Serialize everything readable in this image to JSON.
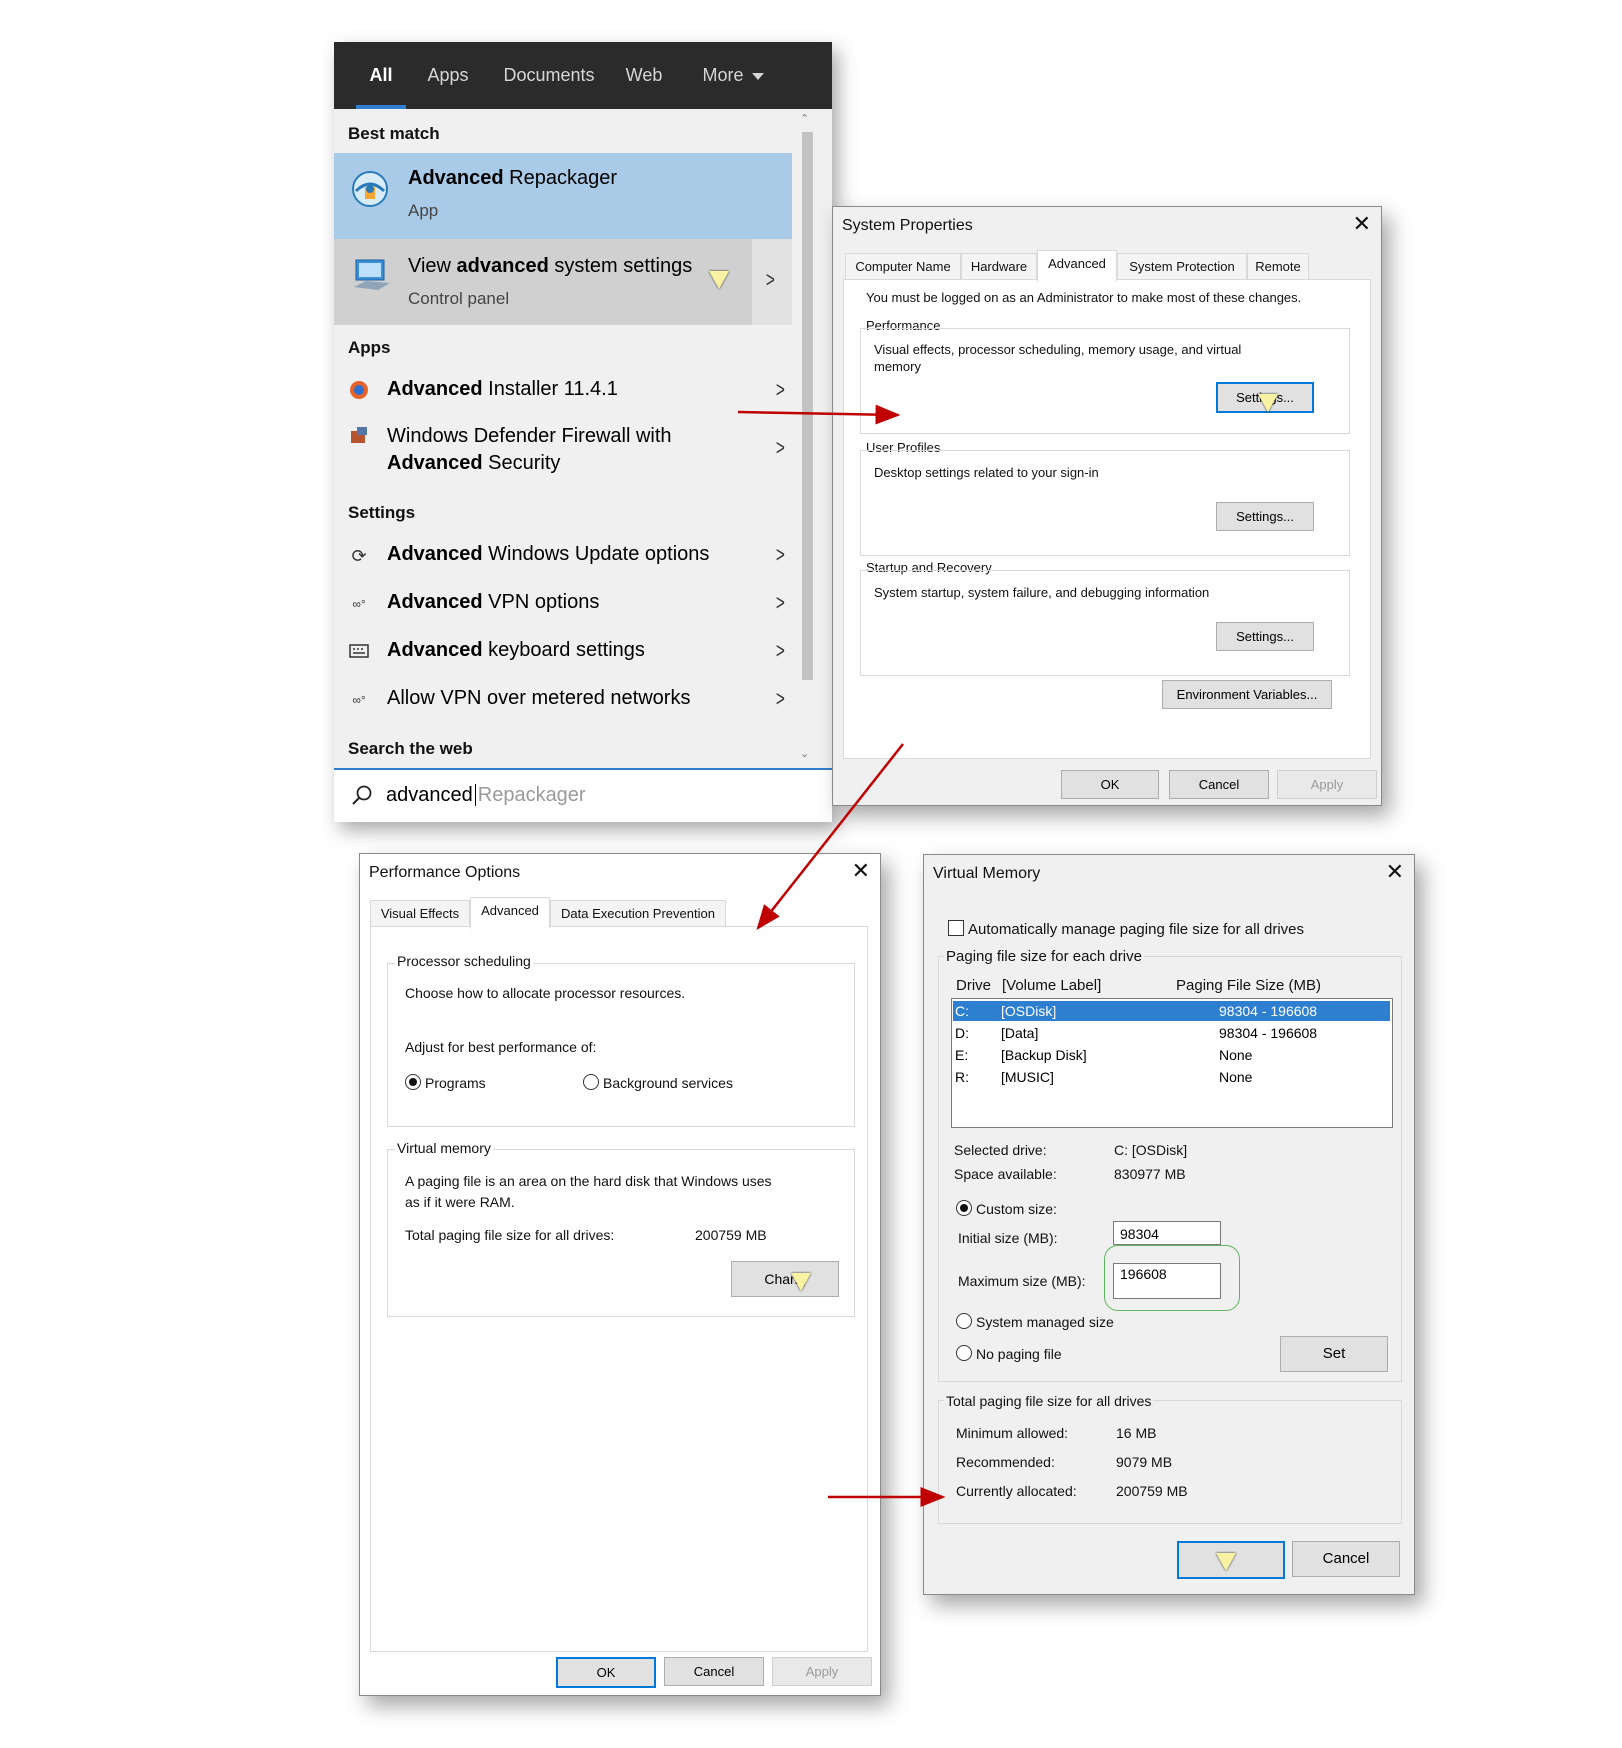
{
  "search": {
    "tabs": [
      "All",
      "Apps",
      "Documents",
      "Web",
      "More"
    ],
    "best_match_heading": "Best match",
    "best": {
      "title_bold": "Advanced",
      "title_rest": " Repackager",
      "subtitle": "App"
    },
    "best2": {
      "title_pre": "View ",
      "title_bold": "advanced",
      "title_rest": " system settings",
      "subtitle": "Control panel"
    },
    "apps_heading": "Apps",
    "apps": [
      {
        "bold": "Advanced",
        "rest": " Installer 11.4.1",
        "icon": "installer-icon"
      },
      {
        "line1": "Windows Defender Firewall with",
        "bold": "Advanced",
        "rest": " Security",
        "icon": "firewall-icon"
      }
    ],
    "settings_heading": "Settings",
    "settings": [
      {
        "bold": "Advanced",
        "rest": " Windows Update options",
        "icon": "sync-icon"
      },
      {
        "bold": "Advanced",
        "rest": " VPN options",
        "icon": "vpn-icon"
      },
      {
        "bold": "Advanced",
        "rest": " keyboard settings",
        "icon": "keyboard-icon"
      },
      {
        "bold": "",
        "rest": "Allow VPN over metered networks",
        "icon": "vpn-icon"
      }
    ],
    "web_heading": "Search the web",
    "query": "advanced",
    "query_suggest": "Repackager"
  },
  "sysprops": {
    "title": "System Properties",
    "tabs": [
      "Computer Name",
      "Hardware",
      "Advanced",
      "System Protection",
      "Remote"
    ],
    "admin_note": "You must be logged on as an Administrator to make most of these changes.",
    "perf_heading": "Performance",
    "perf_desc1": "Visual effects, processor scheduling, memory usage, and virtual",
    "perf_desc2": "memory",
    "perf_btn": "Settings...",
    "profiles_heading": "User Profiles",
    "profiles_desc": "Desktop settings related to your sign-in",
    "profiles_btn": "Settings...",
    "startup_heading": "Startup and Recovery",
    "startup_desc": "System startup, system failure, and debugging information",
    "startup_btn": "Settings...",
    "env_btn": "Environment Variables...",
    "ok": "OK",
    "cancel": "Cancel",
    "apply": "Apply"
  },
  "perfopts": {
    "title": "Performance Options",
    "tabs": [
      "Visual Effects",
      "Advanced",
      "Data Execution Prevention"
    ],
    "proc_heading": "Processor scheduling",
    "proc_desc": "Choose how to allocate processor resources.",
    "adjust": "Adjust for best performance of:",
    "opt_programs": "Programs",
    "opt_background": "Background services",
    "vm_heading": "Virtual memory",
    "vm_desc1": "A paging file is an area on the hard disk that Windows uses",
    "vm_desc2": "as if it were RAM.",
    "vm_total_label": "Total paging file size for all drives:",
    "vm_total_value": "200759 MB",
    "change_btn": "Chang",
    "ok": "OK",
    "cancel": "Cancel",
    "apply": "Apply"
  },
  "vmem": {
    "title": "Virtual Memory",
    "auto_label": "Automatically manage paging file size for all drives",
    "group_heading": "Paging file size for each drive",
    "col_drive": "Drive",
    "col_volume": "[Volume Label]",
    "col_size": "Paging File Size (MB)",
    "drives": [
      {
        "drive": "C:",
        "label": "[OSDisk]",
        "size": "98304 - 196608",
        "selected": true
      },
      {
        "drive": "D:",
        "label": "[Data]",
        "size": "98304 - 196608",
        "selected": false
      },
      {
        "drive": "E:",
        "label": "[Backup Disk]",
        "size": "None",
        "selected": false
      },
      {
        "drive": "R:",
        "label": "[MUSIC]",
        "size": "None",
        "selected": false
      }
    ],
    "selected_drive_label": "Selected drive:",
    "selected_drive_value": "C:  [OSDisk]",
    "space_label": "Space available:",
    "space_value": "830977 MB",
    "custom_size": "Custom size:",
    "initial_label": "Initial size (MB):",
    "initial_value": "98304",
    "max_label": "Maximum size (MB):",
    "max_value": "196608",
    "system_managed": "System managed size",
    "no_paging": "No paging file",
    "set_btn": "Set",
    "total_heading": "Total paging file size for all drives",
    "min_label": "Minimum allowed:",
    "min_value": "16 MB",
    "rec_label": "Recommended:",
    "rec_value": "9079 MB",
    "cur_label": "Currently allocated:",
    "cur_value": "200759 MB",
    "cancel": "Cancel"
  },
  "colors": {
    "accent": "#0078d7",
    "selection": "#2f7fd0",
    "best_match_bg": "#a9cbe8",
    "arrow": "#c00000",
    "highlight_ring": "#5fb35f"
  }
}
